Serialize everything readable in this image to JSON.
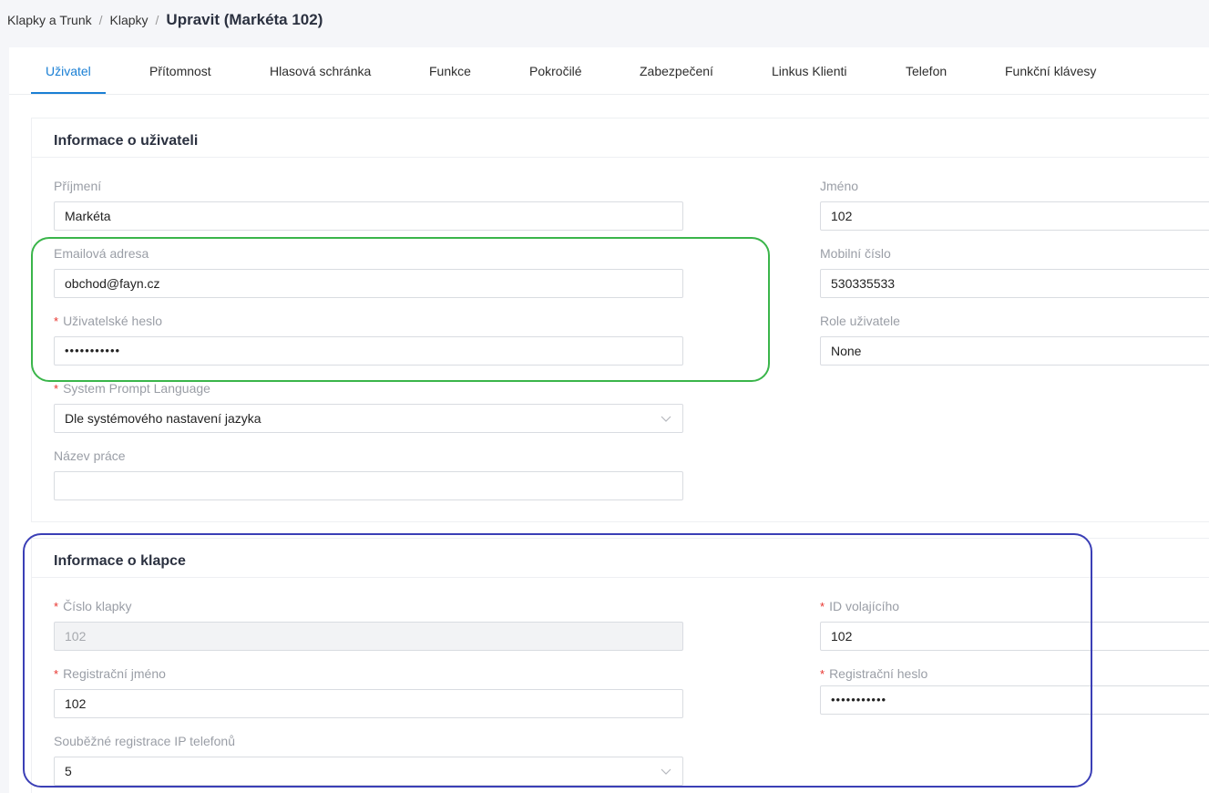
{
  "breadcrumb": {
    "item1": "Klapky a Trunk",
    "item2": "Klapky",
    "separator": "/",
    "current": "Upravit (Markéta 102)"
  },
  "tabs": [
    "Uživatel",
    "Přítomnost",
    "Hlasová schránka",
    "Funkce",
    "Pokročilé",
    "Zabezpečení",
    "Linkus Klienti",
    "Telefon",
    "Funkční klávesy"
  ],
  "active_tab": "Uživatel",
  "required_mark": "*",
  "user_info": {
    "title": "Informace o uživateli",
    "surname_label": "Příjmení",
    "surname_value": "Markéta",
    "firstname_label": "Jméno",
    "firstname_value": "102",
    "email_label": "Emailová adresa",
    "email_value": "obchod@fayn.cz",
    "mobile_label": "Mobilní číslo",
    "mobile_value": "530335533",
    "password_label": "Uživatelské heslo",
    "password_value": "•••••••••••",
    "role_label": "Role uživatele",
    "role_value": "None",
    "language_label": "System Prompt Language",
    "language_value": "Dle systémového nastavení jazyka",
    "job_label": "Název práce",
    "job_value": ""
  },
  "extension_info": {
    "title": "Informace o klapce",
    "ext_number_label": "Číslo klapky",
    "ext_number_value": "102",
    "caller_id_label": "ID volajícího",
    "caller_id_value": "102",
    "reg_name_label": "Registrační jméno",
    "reg_name_value": "102",
    "reg_password_label": "Registrační heslo",
    "reg_password_value": "•••••••••••",
    "concurrent_label": "Souběžné registrace IP telefonů",
    "concurrent_value": "5"
  },
  "colors": {
    "accent": "#1a7fd4",
    "highlight_green": "#3ab54a",
    "highlight_blue": "#3b3fb6",
    "required": "#e8332d"
  },
  "icons": {
    "select_arrow": "chevron-down-icon"
  }
}
